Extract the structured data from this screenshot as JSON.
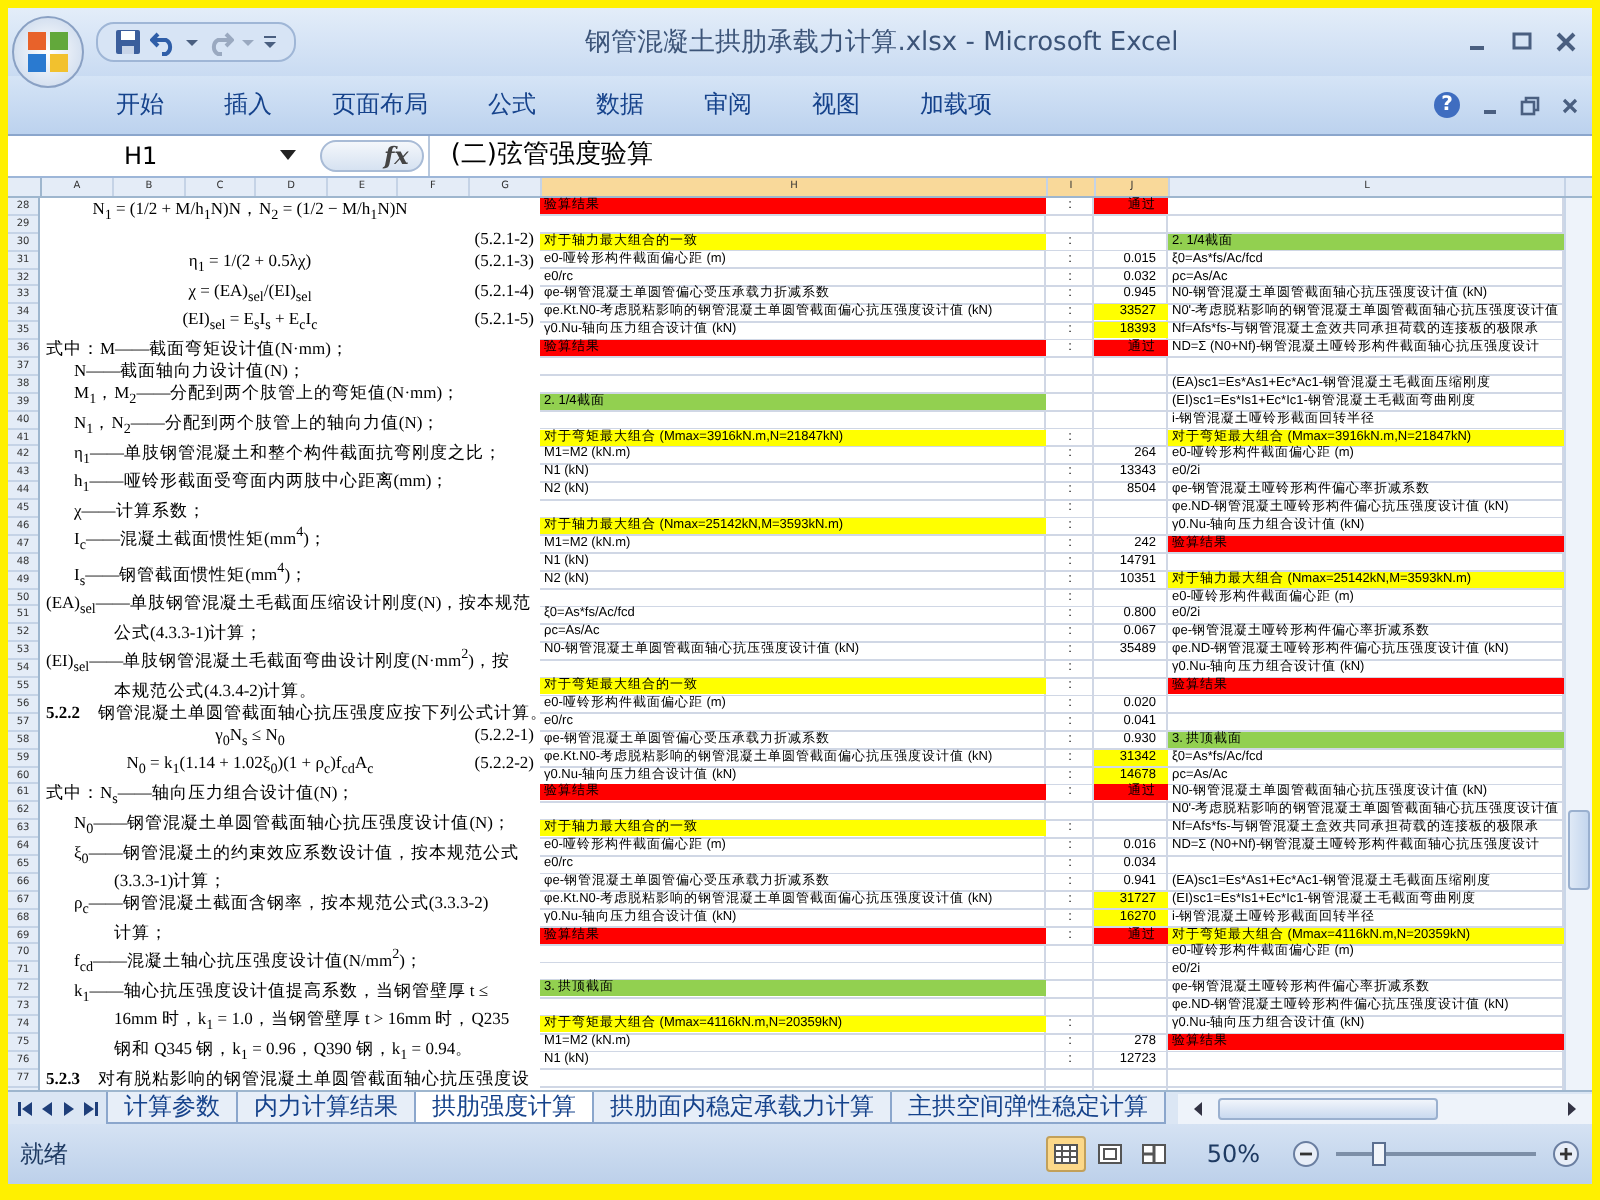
{
  "window": {
    "title": "钢管混凝土拱肋承载力计算.xlsx - Microsoft Excel"
  },
  "ribbon": {
    "tabs": [
      {
        "label": "开始"
      },
      {
        "label": "插入"
      },
      {
        "label": "页面布局"
      },
      {
        "label": "公式"
      },
      {
        "label": "数据"
      },
      {
        "label": "审阅"
      },
      {
        "label": "视图"
      },
      {
        "label": "加载项"
      }
    ],
    "help": "?"
  },
  "formula_bar": {
    "name_box": "H1",
    "fx": "fx",
    "value": "(二)弦管强度验算"
  },
  "columns": [
    {
      "label": "A",
      "selected": false
    },
    {
      "label": "B",
      "selected": false
    },
    {
      "label": "C",
      "selected": false
    },
    {
      "label": "D",
      "selected": false
    },
    {
      "label": "E",
      "selected": false
    },
    {
      "label": "F",
      "selected": false
    },
    {
      "label": "G",
      "selected": false
    },
    {
      "label": "H",
      "selected": true
    },
    {
      "label": "I",
      "selected": true
    },
    {
      "label": "J",
      "selected": true
    },
    {
      "label": "L",
      "selected": false
    }
  ],
  "document_lines": [
    {
      "kind": "formula",
      "text": "N$_{1}$ = (1/2 + M/h$_{1}$N)N，N$_{2}$ = (1/2 − M/h$_{1}$N)N"
    },
    {
      "kind": "formula",
      "num": "(5.2.1-2)"
    },
    {
      "kind": "formula",
      "text": "η$_{1}$ = 1/(2 + 0.5λχ)",
      "num": "(5.2.1-3)"
    },
    {
      "kind": "formula",
      "text": "χ = (EA)$_{sel}$/(EI)$_{sel}$",
      "num": "(5.2.1-4)"
    },
    {
      "kind": "formula",
      "text": "(EI)$_{sel}$ = E$_{s}$I$_{s}$ + E$_{c}$I$_{c}$",
      "num": "(5.2.1-5)"
    },
    {
      "kind": "def",
      "text": "式中：M——截面弯矩设计值(N·mm)；"
    },
    {
      "kind": "term",
      "text": "N——截面轴向力设计值(N)；"
    },
    {
      "kind": "term",
      "text": "M$_{1}$，M$_{2}$——分配到两个肢管上的弯矩值(N·mm)；"
    },
    {
      "kind": "term",
      "text": "N$_{1}$，N$_{2}$——分配到两个肢管上的轴向力值(N)；"
    },
    {
      "kind": "term",
      "text": "η$_{1}$——单肢钢管混凝土和整个构件截面抗弯刚度之比；"
    },
    {
      "kind": "term",
      "text": "h$_{1}$——哑铃形截面受弯面内两肢中心距离(mm)；"
    },
    {
      "kind": "term",
      "text": "χ——计算系数；"
    },
    {
      "kind": "term",
      "text": "I$_{c}$——混凝土截面惯性矩(mm$^{4}$)；"
    },
    {
      "kind": "term",
      "text": "I$_{s}$——钢管截面惯性矩(mm$^{4}$)；"
    },
    {
      "kind": "def",
      "text": "(EA)$_{sel}$——单肢钢管混凝土毛截面压缩设计刚度(N)，按本规范"
    },
    {
      "kind": "cont",
      "text": "公式(4.3.3-1)计算；"
    },
    {
      "kind": "def",
      "text": "(EI)$_{sel}$——单肢钢管混凝土毛截面弯曲设计刚度(N·mm$^{2}$)，按"
    },
    {
      "kind": "cont",
      "text": "本规范公式(4.3.4-2)计算。"
    },
    {
      "kind": "heading",
      "text": "**5.2.2**　钢管混凝土单圆管截面轴心抗压强度应按下列公式计算。"
    },
    {
      "kind": "formula",
      "text": "γ$_{0}$N$_{s}$ ≤ N$_{0}$",
      "num": "(5.2.2-1)"
    },
    {
      "kind": "formula",
      "text": "N$_{0}$ = k$_{1}$(1.14 + 1.02ξ$_{0}$)(1 + ρ$_{c}$)f$_{cd}$A$_{c}$",
      "num": "(5.2.2-2)"
    },
    {
      "kind": "def",
      "text": "式中：N$_{s}$——轴向压力组合设计值(N)；"
    },
    {
      "kind": "term",
      "text": "N$_{0}$——钢管混凝土单圆管截面轴心抗压强度设计值(N)；"
    },
    {
      "kind": "term",
      "text": "ξ$_{0}$——钢管混凝土的约束效应系数设计值，按本规范公式"
    },
    {
      "kind": "cont",
      "text": "(3.3.3-1)计算；"
    },
    {
      "kind": "term",
      "text": "ρ$_{c}$——钢管混凝土截面含钢率，按本规范公式(3.3.3-2)"
    },
    {
      "kind": "cont",
      "text": "计算；"
    },
    {
      "kind": "term",
      "text": "f$_{cd}$——混凝土轴心抗压强度设计值(N/mm$^{2}$)；"
    },
    {
      "kind": "term",
      "text": "k$_{1}$——轴心抗压强度设计值提高系数，当钢管壁厚 t ≤"
    },
    {
      "kind": "cont",
      "text": "16mm 时，k$_{1}$ = 1.0，当钢管壁厚 t > 16mm 时，Q235"
    },
    {
      "kind": "cont",
      "text": "钢和 Q345 钢，k$_{1}$ = 0.96，Q390 钢，k$_{1}$ = 0.94。"
    },
    {
      "kind": "heading",
      "text": "**5.2.3**　对有脱粘影响的钢管混凝土单圆管截面轴心抗压强度设"
    }
  ],
  "rows": [
    {
      "num": "28",
      "h": {
        "text": "验算结果",
        "color": "#ff0000"
      },
      "i": ":",
      "j": {
        "text": "通过",
        "color": "#ff0000"
      }
    },
    {
      "num": "29"
    },
    {
      "num": "30",
      "h": {
        "text": "对于轴力最大组合的一致",
        "color": "#ffff00"
      },
      "i": ":",
      "l": {
        "text": "2. 1/4截面",
        "color": "#92d050"
      }
    },
    {
      "num": "31",
      "h": {
        "text": "e0-哑铃形构件截面偏心距 (m)"
      },
      "i": ":",
      "j": {
        "text": "0.015"
      },
      "l": {
        "text": "ξ0=As*fs/Ac/fcd"
      }
    },
    {
      "num": "32",
      "h": {
        "text": "e0/rc"
      },
      "i": ":",
      "j": {
        "text": "0.032"
      },
      "l": {
        "text": "ρc=As/Ac"
      }
    },
    {
      "num": "33",
      "h": {
        "text": "φe-钢管混凝土单圆管偏心受压承载力折减系数"
      },
      "i": ":",
      "j": {
        "text": "0.945"
      },
      "l": {
        "text": "N0-钢管混凝土单圆管截面轴心抗压强度设计值 (kN)"
      }
    },
    {
      "num": "34",
      "h": {
        "text": "φe.Kt.N0-考虑脱粘影响的钢管混凝土单圆管截面偏心抗压强度设计值 (kN)"
      },
      "i": ":",
      "j": {
        "text": "33527",
        "color": "#ffff00"
      },
      "l": {
        "text": "N0'-考虑脱粘影响的钢管混凝土单圆管截面轴心抗压强度设计值"
      }
    },
    {
      "num": "35",
      "h": {
        "text": "γ0.Nu-轴向压力组合设计值 (kN)"
      },
      "i": ":",
      "j": {
        "text": "18393",
        "color": "#ffff00"
      },
      "l": {
        "text": "Nf=Afs*fs-与钢管混凝土盒效共同承担荷载的连接板的极限承"
      }
    },
    {
      "num": "36",
      "h": {
        "text": "验算结果",
        "color": "#ff0000"
      },
      "i": ":",
      "j": {
        "text": "通过",
        "color": "#ff0000"
      },
      "l": {
        "text": "ND=Σ (N0+Nf)-钢管混凝土哑铃形构件截面轴心抗压强度设计"
      }
    },
    {
      "num": "37"
    },
    {
      "num": "38",
      "l": {
        "text": "(EA)sc1=Es*As1+Ec*Ac1-钢管混凝土毛截面压缩刚度"
      }
    },
    {
      "num": "39",
      "h": {
        "text": "2. 1/4截面",
        "color": "#92d050"
      },
      "l": {
        "text": "(EI)sc1=Es*Is1+Ec*Ic1-钢管混凝土毛截面弯曲刚度"
      }
    },
    {
      "num": "40",
      "l": {
        "text": "i-钢管混凝土哑铃形截面回转半径"
      }
    },
    {
      "num": "41",
      "h": {
        "text": "对于弯矩最大组合 (Mmax=3916kN.m,N=21847kN)",
        "color": "#ffff00"
      },
      "i": ":",
      "l": {
        "text": "对于弯矩最大组合 (Mmax=3916kN.m,N=21847kN)",
        "color": "#ffff00"
      }
    },
    {
      "num": "42",
      "h": {
        "text": "M1=M2 (kN.m)"
      },
      "i": ":",
      "j": {
        "text": "264"
      },
      "l": {
        "text": "e0-哑铃形构件截面偏心距 (m)"
      }
    },
    {
      "num": "43",
      "h": {
        "text": "N1 (kN)"
      },
      "i": ":",
      "j": {
        "text": "13343"
      },
      "l": {
        "text": "e0/2i"
      }
    },
    {
      "num": "44",
      "h": {
        "text": "N2 (kN)"
      },
      "i": ":",
      "j": {
        "text": "8504"
      },
      "l": {
        "text": "φe-钢管混凝土哑铃形构件偏心率折减系数"
      }
    },
    {
      "num": "45",
      "i": ":",
      "l": {
        "text": "φe.ND-钢管混凝土哑铃形构件偏心抗压强度设计值 (kN)"
      }
    },
    {
      "num": "46",
      "h": {
        "text": "对于轴力最大组合 (Nmax=25142kN,M=3593kN.m)",
        "color": "#ffff00"
      },
      "i": ":",
      "l": {
        "text": "γ0.Nu-轴向压力组合设计值 (kN)"
      }
    },
    {
      "num": "47",
      "h": {
        "text": "M1=M2 (kN.m)"
      },
      "i": ":",
      "j": {
        "text": "242"
      },
      "l": {
        "text": "验算结果",
        "color": "#ff0000"
      }
    },
    {
      "num": "48",
      "h": {
        "text": "N1 (kN)"
      },
      "i": ":",
      "j": {
        "text": "14791"
      }
    },
    {
      "num": "49",
      "h": {
        "text": "N2 (kN)"
      },
      "i": ":",
      "j": {
        "text": "10351"
      },
      "l": {
        "text": "对于轴力最大组合 (Nmax=25142kN,M=3593kN.m)",
        "color": "#ffff00"
      }
    },
    {
      "num": "50",
      "i": ":",
      "l": {
        "text": "e0-哑铃形构件截面偏心距 (m)"
      }
    },
    {
      "num": "51",
      "h": {
        "text": "ξ0=As*fs/Ac/fcd"
      },
      "i": ":",
      "j": {
        "text": "0.800"
      },
      "l": {
        "text": "e0/2i"
      }
    },
    {
      "num": "52",
      "h": {
        "text": "ρc=As/Ac"
      },
      "i": ":",
      "j": {
        "text": "0.067"
      },
      "l": {
        "text": "φe-钢管混凝土哑铃形构件偏心率折减系数"
      }
    },
    {
      "num": "53",
      "h": {
        "text": "N0-钢管混凝土单圆管截面轴心抗压强度设计值 (kN)"
      },
      "i": ":",
      "j": {
        "text": "35489"
      },
      "l": {
        "text": "φe.ND-钢管混凝土哑铃形构件偏心抗压强度设计值 (kN)"
      }
    },
    {
      "num": "54",
      "i": ":",
      "l": {
        "text": "γ0.Nu-轴向压力组合设计值 (kN)"
      }
    },
    {
      "num": "55",
      "h": {
        "text": "对于弯矩最大组合的一致",
        "color": "#ffff00"
      },
      "i": ":",
      "l": {
        "text": "验算结果",
        "color": "#ff0000"
      }
    },
    {
      "num": "56",
      "h": {
        "text": "e0-哑铃形构件截面偏心距 (m)"
      },
      "i": ":",
      "j": {
        "text": "0.020"
      }
    },
    {
      "num": "57",
      "h": {
        "text": "e0/rc"
      },
      "i": ":",
      "j": {
        "text": "0.041"
      }
    },
    {
      "num": "58",
      "h": {
        "text": "φe-钢管混凝土单圆管偏心受压承载力折减系数"
      },
      "i": ":",
      "j": {
        "text": "0.930"
      },
      "l": {
        "text": "3. 拱顶截面",
        "color": "#92d050"
      }
    },
    {
      "num": "59",
      "h": {
        "text": "φe.Kt.N0-考虑脱粘影响的钢管混凝土单圆管截面偏心抗压强度设计值 (kN)"
      },
      "i": ":",
      "j": {
        "text": "31342",
        "color": "#ffff00"
      },
      "l": {
        "text": "ξ0=As*fs/Ac/fcd"
      }
    },
    {
      "num": "60",
      "h": {
        "text": "γ0.Nu-轴向压力组合设计值 (kN)"
      },
      "i": ":",
      "j": {
        "text": "14678",
        "color": "#ffff00"
      },
      "l": {
        "text": "ρc=As/Ac"
      }
    },
    {
      "num": "61",
      "h": {
        "text": "验算结果",
        "color": "#ff0000"
      },
      "i": ":",
      "j": {
        "text": "通过",
        "color": "#ff0000"
      },
      "l": {
        "text": "N0-钢管混凝土单圆管截面轴心抗压强度设计值 (kN)"
      }
    },
    {
      "num": "62",
      "l": {
        "text": "N0'-考虑脱粘影响的钢管混凝土单圆管截面轴心抗压强度设计值"
      }
    },
    {
      "num": "63",
      "h": {
        "text": "对于轴力最大组合的一致",
        "color": "#ffff00"
      },
      "i": ":",
      "l": {
        "text": "Nf=Afs*fs-与钢管混凝土盒效共同承担荷载的连接板的极限承"
      }
    },
    {
      "num": "64",
      "h": {
        "text": "e0-哑铃形构件截面偏心距 (m)"
      },
      "i": ":",
      "j": {
        "text": "0.016"
      },
      "l": {
        "text": "ND=Σ (N0+Nf)-钢管混凝土哑铃形构件截面轴心抗压强度设计"
      }
    },
    {
      "num": "65",
      "h": {
        "text": "e0/rc"
      },
      "i": ":",
      "j": {
        "text": "0.034"
      }
    },
    {
      "num": "66",
      "h": {
        "text": "φe-钢管混凝土单圆管偏心受压承载力折减系数"
      },
      "i": ":",
      "j": {
        "text": "0.941"
      },
      "l": {
        "text": "(EA)sc1=Es*As1+Ec*Ac1-钢管混凝土毛截面压缩刚度"
      }
    },
    {
      "num": "67",
      "h": {
        "text": "φe.Kt.N0-考虑脱粘影响的钢管混凝土单圆管截面偏心抗压强度设计值 (kN)"
      },
      "i": ":",
      "j": {
        "text": "31727",
        "color": "#ffff00"
      },
      "l": {
        "text": "(EI)sc1=Es*Is1+Ec*Ic1-钢管混凝土毛截面弯曲刚度"
      }
    },
    {
      "num": "68",
      "h": {
        "text": "γ0.Nu-轴向压力组合设计值 (kN)"
      },
      "i": ":",
      "j": {
        "text": "16270",
        "color": "#ffff00"
      },
      "l": {
        "text": "i-钢管混凝土哑铃形截面回转半径"
      }
    },
    {
      "num": "69",
      "h": {
        "text": "验算结果",
        "color": "#ff0000"
      },
      "i": ":",
      "j": {
        "text": "通过",
        "color": "#ff0000"
      },
      "l": {
        "text": "对于弯矩最大组合 (Mmax=4116kN.m,N=20359kN)",
        "color": "#ffff00"
      }
    },
    {
      "num": "70",
      "l": {
        "text": "e0-哑铃形构件截面偏心距 (m)"
      }
    },
    {
      "num": "71",
      "l": {
        "text": "e0/2i"
      }
    },
    {
      "num": "72",
      "h": {
        "text": "3. 拱顶截面",
        "color": "#92d050"
      },
      "l": {
        "text": "φe-钢管混凝土哑铃形构件偏心率折减系数"
      }
    },
    {
      "num": "73",
      "l": {
        "text": "φe.ND-钢管混凝土哑铃形构件偏心抗压强度设计值 (kN)"
      }
    },
    {
      "num": "74",
      "h": {
        "text": "对于弯矩最大组合 (Mmax=4116kN.m,N=20359kN)",
        "color": "#ffff00"
      },
      "i": ":",
      "l": {
        "text": "γ0.Nu-轴向压力组合设计值 (kN)"
      }
    },
    {
      "num": "75",
      "h": {
        "text": "M1=M2 (kN.m)"
      },
      "i": ":",
      "j": {
        "text": "278"
      },
      "l": {
        "text": "验算结果",
        "color": "#ff0000"
      }
    },
    {
      "num": "76",
      "h": {
        "text": "N1 (kN)"
      },
      "i": ":",
      "j": {
        "text": "12723"
      }
    },
    {
      "num": "77"
    }
  ],
  "sheet_tabs": [
    {
      "label": "计算参数",
      "selected": false
    },
    {
      "label": "内力计算结果",
      "selected": false
    },
    {
      "label": "拱肋强度计算",
      "selected": true
    },
    {
      "label": "拱肋面内稳定承载力计算",
      "selected": false
    },
    {
      "label": "主拱空间弹性稳定计算",
      "selected": false
    }
  ],
  "status_bar": {
    "text": "就绪",
    "views": [
      {
        "kind": "normal",
        "selected": true
      },
      {
        "kind": "page_layout",
        "selected": false
      },
      {
        "kind": "page_break",
        "selected": false
      }
    ],
    "zoom": "50%",
    "zoom_slider": {
      "level": 0.21
    }
  }
}
